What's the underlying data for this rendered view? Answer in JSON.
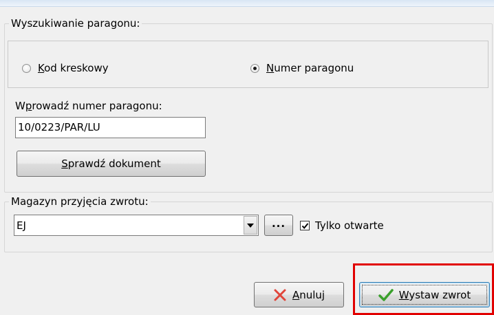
{
  "search_group": {
    "legend": "Wyszukiwanie paragonu:",
    "radio_barcode": {
      "prefix": "",
      "accel": "K",
      "rest": "od kreskowy",
      "checked": false
    },
    "radio_receipt": {
      "prefix": "",
      "accel": "N",
      "rest": "umer paragonu",
      "checked": true
    },
    "input_label": {
      "prefix": "W",
      "accel": "p",
      "rest": "rowadź numer paragonu:"
    },
    "receipt_number": "10/0223/PAR/LU",
    "check_button": {
      "prefix": "",
      "accel": "S",
      "rest": "prawdź dokument"
    }
  },
  "warehouse_group": {
    "legend": "Magazyn przyjęcia zwrotu:",
    "warehouse_value": "EJ",
    "browse_label": "...",
    "only_open_label": "Tylko otwarte",
    "only_open_checked": true
  },
  "footer": {
    "cancel": {
      "prefix": "",
      "accel": "A",
      "rest": "nuluj"
    },
    "issue_return": {
      "prefix": "",
      "accel": "W",
      "rest": "ystaw zwrot"
    }
  },
  "colors": {
    "highlight": "#e10000",
    "cancel_icon": "#e0453a",
    "ok_icon": "#3aa02c"
  },
  "icons": {
    "cancel": "x-icon",
    "ok": "checkmark-icon"
  }
}
